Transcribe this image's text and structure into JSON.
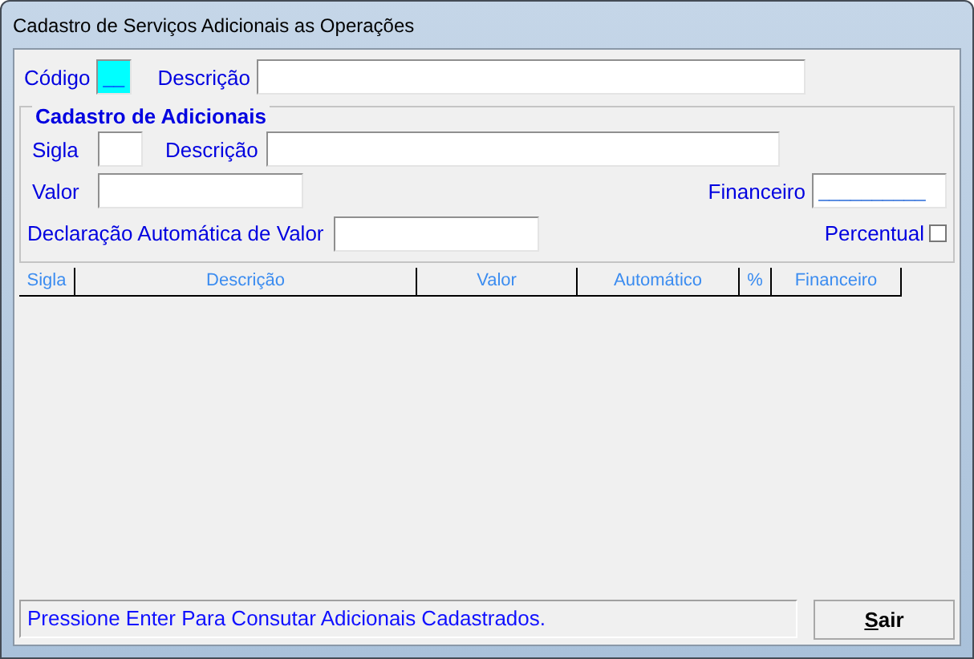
{
  "window": {
    "title": "Cadastro de Serviços Adicionais as Operações"
  },
  "header": {
    "code_label": "Código",
    "code_value": "__",
    "description_label": "Descrição"
  },
  "group": {
    "title": "Cadastro de Adicionais",
    "sigla_label": "Sigla",
    "description_label": "Descrição",
    "valor_label": "Valor",
    "financeiro_label": "Financeiro",
    "financeiro_value": "__________",
    "auto_label": "Declaração Automática de Valor",
    "percentual_label": "Percentual",
    "percentual_checked": false
  },
  "table": {
    "columns": [
      "Sigla",
      "Descrição",
      "Valor",
      "Automático",
      "%",
      "Financeiro"
    ]
  },
  "status_bar": "Pressione Enter Para Consutar Adicionais Cadastrados.",
  "buttons": [
    {
      "label": "Sair",
      "first_letter_underlined": true
    }
  ]
}
